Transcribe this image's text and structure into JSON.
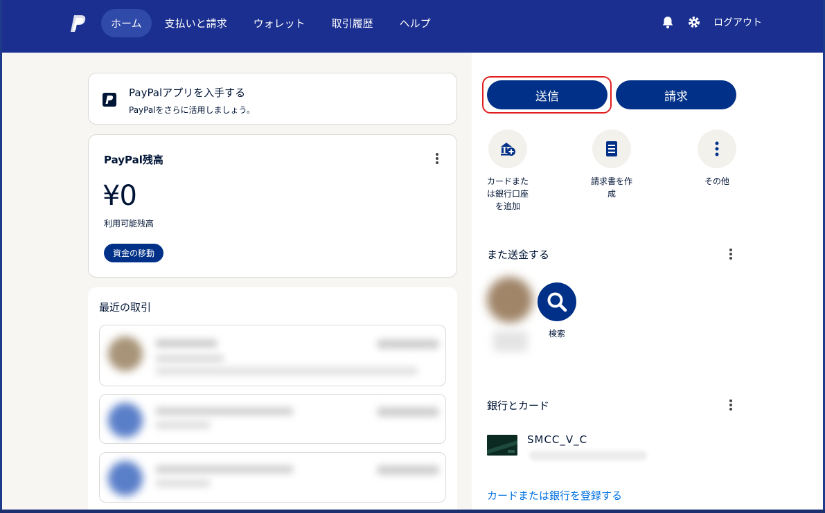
{
  "header": {
    "logo_name": "paypal-logo",
    "nav": [
      "ホーム",
      "支払いと請求",
      "ウォレット",
      "取引履歴",
      "ヘルプ"
    ],
    "active_index": 0,
    "logout_label": "ログアウト"
  },
  "app_card": {
    "title": "PayPalアプリを入手する",
    "subtitle": "PayPalをさらに活用しましょう。"
  },
  "balance": {
    "title": "PayPal残高",
    "amount": "¥0",
    "label": "利用可能残高",
    "move_button": "資金の移動"
  },
  "transactions": {
    "title": "最近の取引"
  },
  "actions": {
    "send_label": "送信",
    "request_label": "請求",
    "quick": [
      {
        "label": "カードまた\nは銀行口座\nを追加",
        "icon": "bank-add-icon"
      },
      {
        "label": "請求書を作\n成",
        "icon": "invoice-icon"
      },
      {
        "label": "その他",
        "icon": "more-vertical-icon"
      }
    ]
  },
  "send_again": {
    "title": "また送金する",
    "search_label": "検索"
  },
  "banks": {
    "title": "銀行とカード",
    "card_name": "SMCC_V_C",
    "link_label": "カードまたは銀行を登録する"
  },
  "colors": {
    "header_bg": "#1a2f8f",
    "primary": "#003087",
    "link": "#0070e0",
    "highlight": "#e11d1d"
  }
}
